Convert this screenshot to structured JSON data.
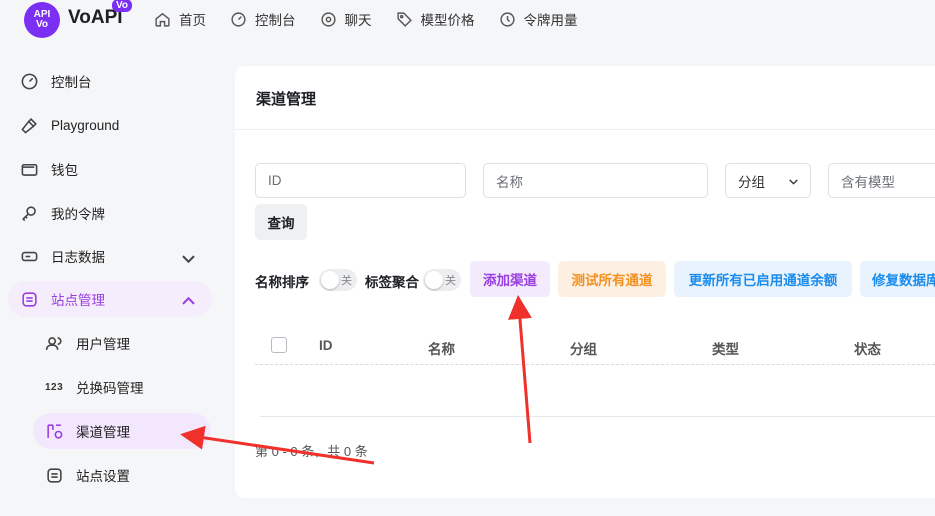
{
  "header": {
    "logo_text": "API",
    "logo_subtext": "Vo",
    "brand": "VoAPI",
    "brand_badge": "Vo",
    "nav": [
      {
        "label": "首页",
        "icon": "home-icon"
      },
      {
        "label": "控制台",
        "icon": "gauge-icon"
      },
      {
        "label": "聊天",
        "icon": "chat-icon"
      },
      {
        "label": "模型价格",
        "icon": "tag-icon"
      },
      {
        "label": "令牌用量",
        "icon": "clock-icon"
      }
    ]
  },
  "sidebar": {
    "items": [
      {
        "label": "控制台",
        "icon": "gauge-icon"
      },
      {
        "label": "Playground",
        "icon": "hammer-icon"
      },
      {
        "label": "钱包",
        "icon": "wallet-icon"
      },
      {
        "label": "我的令牌",
        "icon": "key-icon"
      },
      {
        "label": "日志数据",
        "icon": "log-icon"
      },
      {
        "label": "站点管理",
        "icon": "admin-icon"
      }
    ],
    "sub_items": [
      {
        "label": "用户管理",
        "icon": "users-icon"
      },
      {
        "label": "兑换码管理",
        "icon": "123-icon",
        "icon_text": "123"
      },
      {
        "label": "渠道管理",
        "icon": "channel-icon"
      },
      {
        "label": "站点设置",
        "icon": "settings-icon"
      }
    ],
    "active_color": "#9a3ee0"
  },
  "main": {
    "title": "渠道管理",
    "filters": {
      "id_placeholder": "ID",
      "name_placeholder": "名称",
      "group_label": "分组",
      "model_placeholder": "含有模型"
    },
    "query_button": "查询",
    "toggles": [
      {
        "label": "名称排序",
        "state": "关"
      },
      {
        "label": "标签聚合",
        "state": "关"
      }
    ],
    "actions": {
      "add": "添加渠道",
      "test_all": "测试所有通道",
      "update_balance": "更新所有已启用通道余额",
      "repair": "修复数据库"
    },
    "table": {
      "columns": [
        "ID",
        "名称",
        "分组",
        "类型",
        "状态"
      ]
    },
    "pager": "第 0 - 0 条，共 0 条"
  },
  "colors": {
    "accent": "#7b2ff2",
    "purple": "#9a3ee0",
    "orange": "#f29120",
    "blue": "#1b8ceb",
    "arrow": "#f0302a"
  }
}
